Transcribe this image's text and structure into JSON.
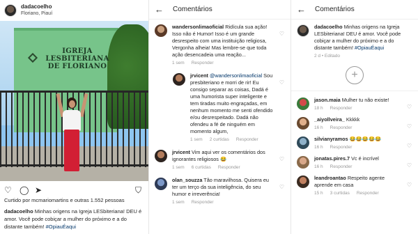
{
  "post": {
    "username": "dadacoelho",
    "location": "Floriano, Piauí",
    "sign_line1": "IGREJA",
    "sign_line2": "LESBITERIANA",
    "sign_line3": "DE FLORIANO",
    "likes_text": "Curtido por mcmariomartins e outras 1.552 pessoas",
    "caption_user": "dadacoelho",
    "caption_text": " Minhas origens na Igreja LESbiteriana! DEU é amor. Você pode cobiçar a mulher do próximo e a do distante também! ",
    "caption_hashtag": "#OpiauÉaqui",
    "icons": [
      "heart-icon",
      "comment-icon",
      "share-icon",
      "bookmark-icon"
    ]
  },
  "comments_mid": {
    "back": "←",
    "title": "Comentários",
    "items": [
      {
        "user": "wandersonlimaoficial",
        "text": " Ridícula sua ação! Isso não é Humor! Isso é um grande desrespeito com uma instituição religiosa, Vergonha alheia! Mas lembre-se que toda ação desencadeia uma reação...",
        "time": "1 sem",
        "reply": "Responder"
      },
      {
        "user": "jrvicent",
        "mention": " @wandersonlimaoficial",
        "text": " Sou presbiteriano e morri de rir! Eu consigo separar as coisas, Dadá é uma humorista super inteligente e tem tiradas muito engraçadas, em nenhum momento me senti ofendido e/ou desrespeitado. Dadá não ofendeu a fé de ninguém em momento algum,",
        "time": "1 sem",
        "likes": "2 curtidas",
        "reply": "Responder"
      },
      {
        "user": "jrvicent",
        "text": " Vim aqui ver os comentários dos ignorantes religiosos 😂",
        "time": "1 sem",
        "likes": "6 curtidas",
        "reply": "Responder"
      },
      {
        "user": "olan_souzza",
        "text": " Tão maravilhosa. Quisera eu ter um terço da sua inteligência, do seu humor e irreverência!",
        "time": "1 sem",
        "reply": "Responder"
      }
    ]
  },
  "comments_right": {
    "back": "←",
    "title": "Comentários",
    "caption_user": "dadacoelho",
    "caption_text": " Minhas origens na Igreja LESbiteriana! DEU é amor. Você pode cobiçar a mulher do próximo e a do distante também! ",
    "caption_hashtag": "#OpiauÉaqui",
    "caption_meta": "2 d • Editado",
    "add_symbol": "+",
    "items": [
      {
        "user": "jason.maia",
        "text": " Mulher tu não existe!",
        "time": "18 h",
        "reply": "Responder"
      },
      {
        "user": "_aiyollveira_",
        "text": " Kkkkk",
        "time": "16 h",
        "reply": "Responder"
      },
      {
        "user": "silvianyramos",
        "text": " 😂😂😂😂😂",
        "time": "16 h",
        "reply": "Responder"
      },
      {
        "user": "jonatas.pires.7",
        "text": " Vc é incrível",
        "time": "16 h",
        "reply": "Responder"
      },
      {
        "user": "leandroantao",
        "text": " Respeito agente aprende em casa",
        "time": "15 h",
        "likes": "3 curtidas",
        "reply": "Responder"
      }
    ]
  }
}
